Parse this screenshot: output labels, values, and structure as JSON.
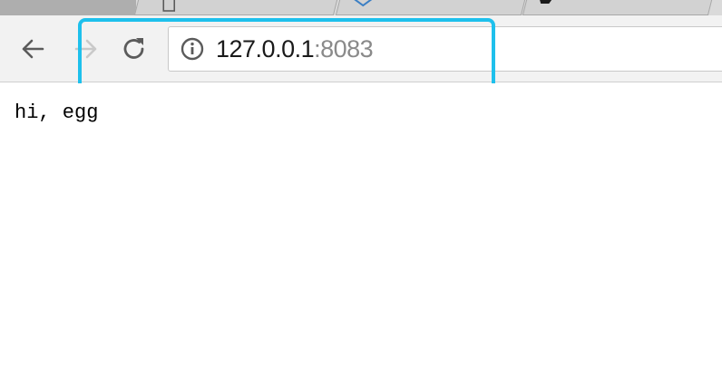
{
  "browser": {
    "address_bar": {
      "host": "127.0.0.1",
      "port": ":8083"
    },
    "icons": {
      "back": "back-arrow-icon",
      "forward": "forward-arrow-icon",
      "reload": "reload-icon",
      "site_info": "info-icon"
    },
    "highlight_color": "#1ec0ec"
  },
  "page": {
    "body_text": "hi, egg"
  }
}
